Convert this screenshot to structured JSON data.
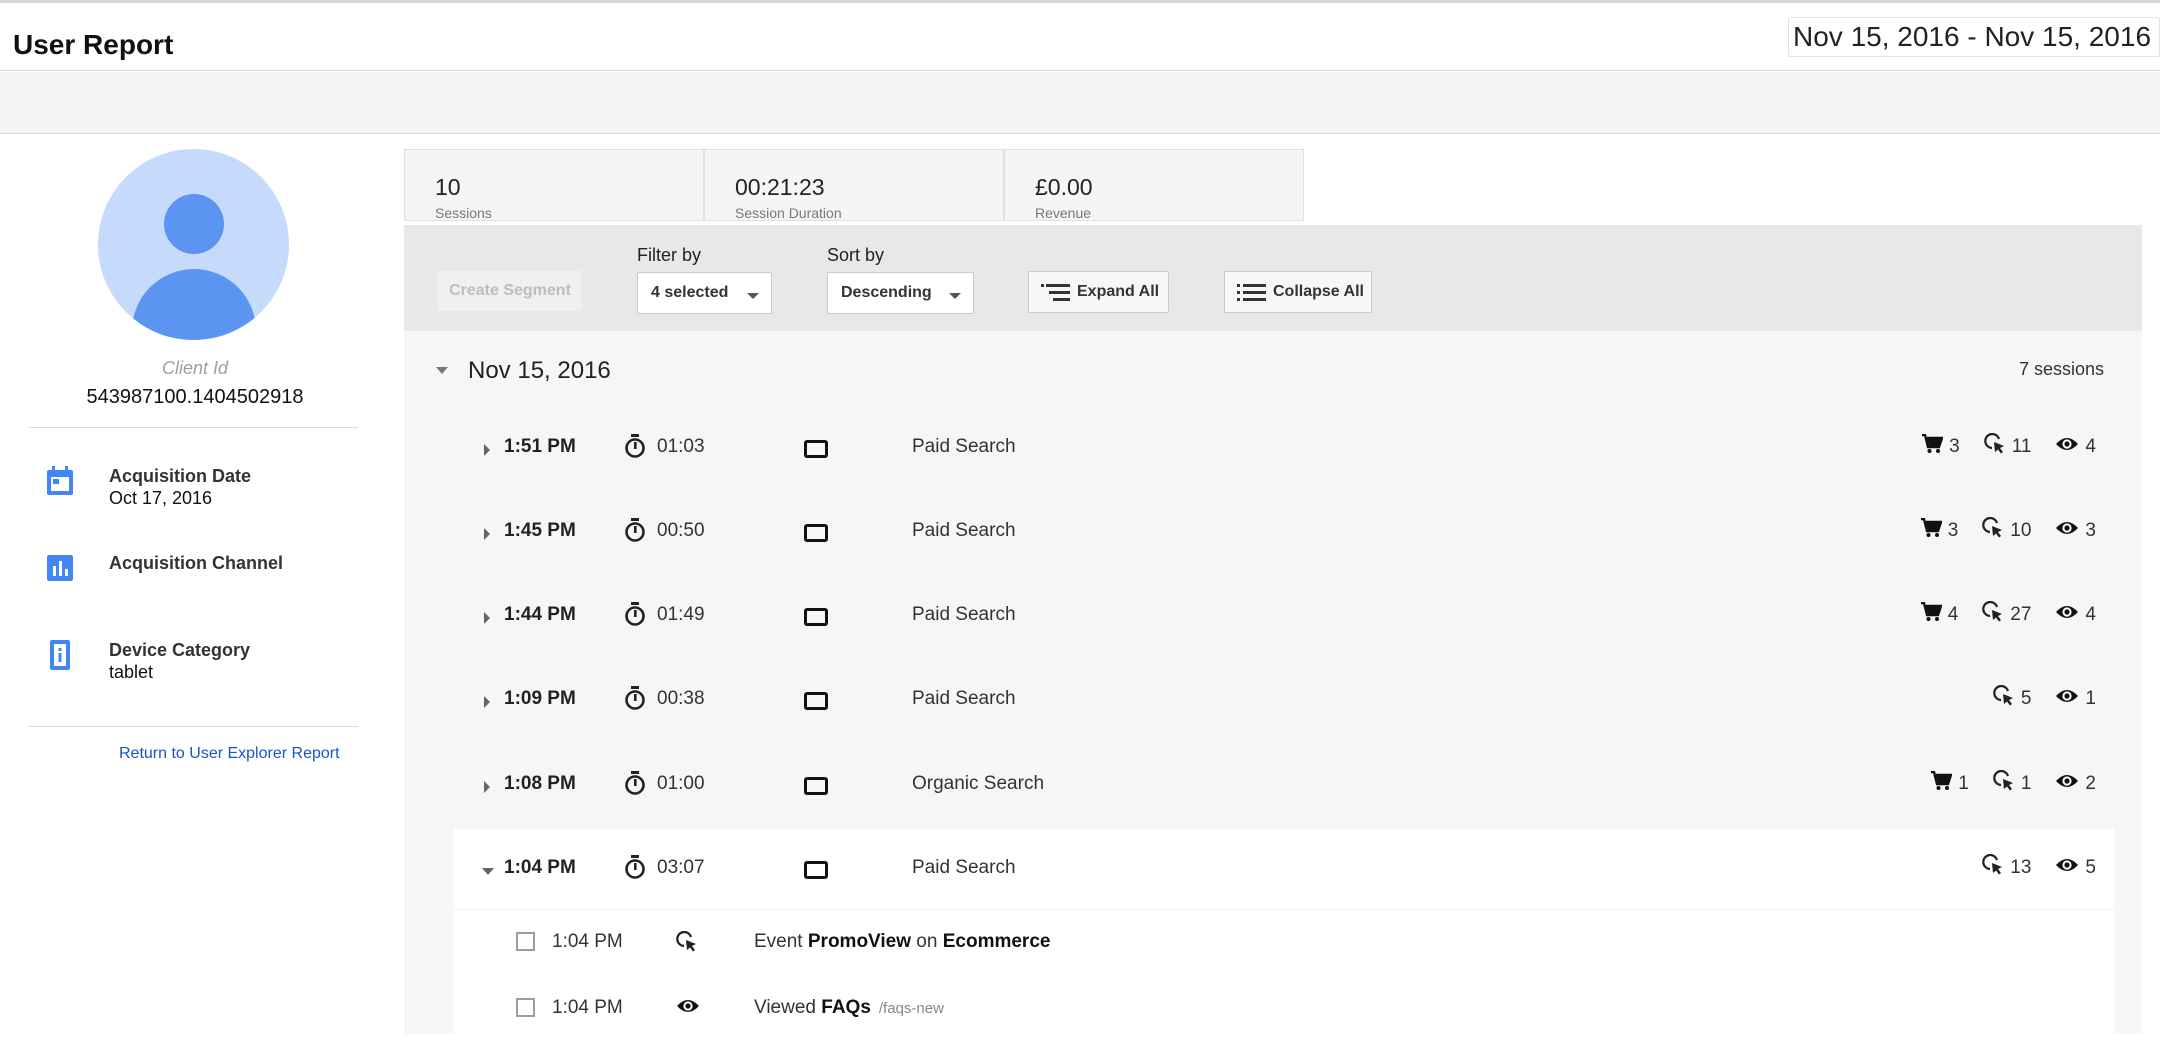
{
  "header": {
    "title": "User Report",
    "date_range": "Nov 15, 2016 - Nov 15, 2016"
  },
  "profile": {
    "client_label": "Client Id",
    "client_id": "543987100.1404502918",
    "acquisition_date_label": "Acquisition Date",
    "acquisition_date": "Oct 17, 2016",
    "acquisition_channel_label": "Acquisition Channel",
    "device_category_label": "Device Category",
    "device_category": "tablet",
    "return_link": "Return to User Explorer Report"
  },
  "summary": [
    {
      "value": "10",
      "label": "Sessions"
    },
    {
      "value": "00:21:23",
      "label": "Session Duration"
    },
    {
      "value": "£0.00",
      "label": "Revenue"
    }
  ],
  "controls": {
    "create_segment": "Create Segment",
    "filter_label": "Filter by",
    "filter_value": "4 selected",
    "sort_label": "Sort by",
    "sort_value": "Descending",
    "expand_all": "Expand All",
    "collapse_all": "Collapse All"
  },
  "day": {
    "date": "Nov 15, 2016",
    "count": "7 sessions"
  },
  "sessions": [
    {
      "time": "1:51 PM",
      "duration": "01:03",
      "source": "Paid Search",
      "cart": "3",
      "events": "11",
      "views": "4"
    },
    {
      "time": "1:45 PM",
      "duration": "00:50",
      "source": "Paid Search",
      "cart": "3",
      "events": "10",
      "views": "3"
    },
    {
      "time": "1:44 PM",
      "duration": "01:49",
      "source": "Paid Search",
      "cart": "4",
      "events": "27",
      "views": "4"
    },
    {
      "time": "1:09 PM",
      "duration": "00:38",
      "source": "Paid Search",
      "events": "5",
      "views": "1"
    },
    {
      "time": "1:08 PM",
      "duration": "01:00",
      "source": "Organic Search",
      "cart": "1",
      "events": "1",
      "views": "2"
    },
    {
      "time": "1:04 PM",
      "duration": "03:07",
      "source": "Paid Search",
      "events": "13",
      "views": "5"
    }
  ],
  "activities": [
    {
      "time": "1:04 PM",
      "prefix": "Event",
      "name": "PromoView",
      "joiner": "on",
      "category": "Ecommerce"
    },
    {
      "time": "1:04 PM",
      "prefix": "Viewed",
      "name": "FAQs",
      "path": "/faqs-new"
    }
  ],
  "icons": {
    "accent": "#4285f4",
    "avatar_bg": "#c6dafc",
    "link_color": "#1a53c9"
  }
}
